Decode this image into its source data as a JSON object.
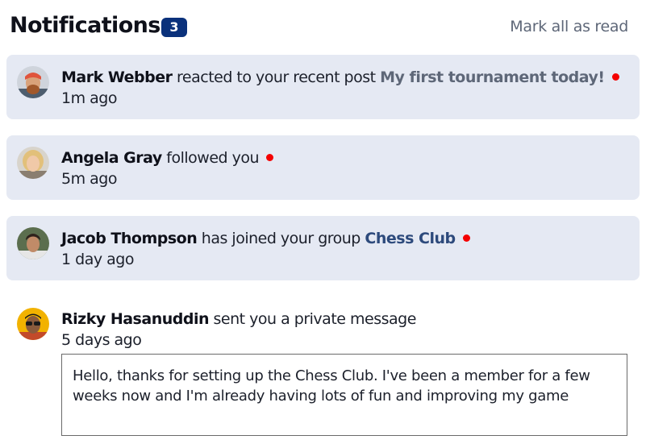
{
  "header": {
    "title": "Notifications",
    "unread_count": "3",
    "mark_all_label": "Mark all as read"
  },
  "notifications": [
    {
      "name": "Mark Webber",
      "action": " reacted to your recent post ",
      "target": "My first tournament today!",
      "time": "1m ago",
      "unread": true
    },
    {
      "name": "Angela Gray",
      "action": " followed you",
      "time": "5m ago",
      "unread": true
    },
    {
      "name": "Jacob Thompson",
      "action": " has joined your group ",
      "target": "Chess Club",
      "time": "1 day ago",
      "unread": true
    },
    {
      "name": "Rizky Hasanuddin",
      "action": " sent you a private message",
      "time": "5 days ago",
      "unread": false,
      "message": "Hello, thanks for setting up the Chess Club. I've been a member for a few weeks now and I'm already having lots of fun and improving my game"
    }
  ],
  "colors": {
    "unread_bg": "#e5e9f3",
    "badge": "#0a317b",
    "dot": "#f40000",
    "muted": "#5e6778"
  }
}
